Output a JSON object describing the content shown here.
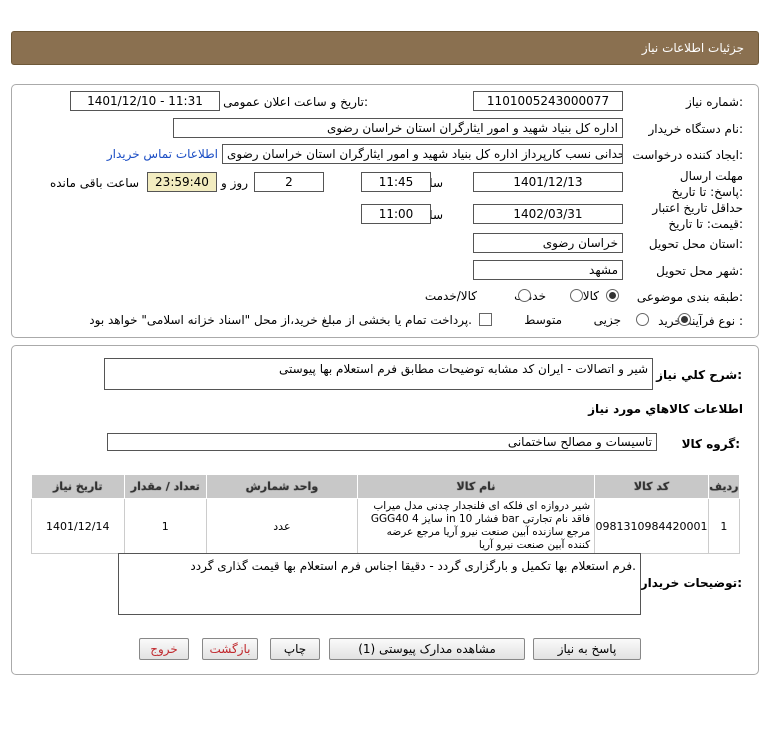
{
  "header": {
    "title": "جزئیات اطلاعات نیاز"
  },
  "form": {
    "need_number_label": "شماره نیاز:",
    "need_number": "1101005243000077",
    "announce_label": "تاریخ و ساعت اعلان عمومی:",
    "announce_value": "1401/12/10 - 11:31",
    "buyer_org_label": "نام دستگاه خریدار:",
    "buyer_org": "اداره کل بنیاد شهید و امور ایثارگران استان خراسان رضوی",
    "creator_label": "ایجاد کننده درخواست:",
    "creator": "حسین وحدانی نسب کارپرداز اداره کل بنیاد شهید و امور ایثارگران استان خراسان رضوی",
    "contact_link": "اطلاعات تماس خریدار",
    "deadline_label": "مهلت ارسال پاسخ: تا تاریخ:",
    "deadline_date": "1401/12/13",
    "time_label": "ساعت",
    "deadline_time": "11:45",
    "days_value": "2",
    "days_label": "روز و",
    "remaining_time": "23:59:40",
    "remaining_label": "ساعت باقی مانده",
    "validity_label": "حداقل تاریخ اعتبار قیمت: تا تاریخ:",
    "validity_date": "1402/03/31",
    "validity_time_label": "ساعت",
    "validity_time": "11:00",
    "province_label": "استان محل تحویل:",
    "province": "خراسان رضوی",
    "city_label": "شهر محل تحویل:",
    "city": "مشهد",
    "category_label": "طبقه بندی موضوعی:",
    "category_options": [
      "کالا",
      "خدمت",
      "کالا/خدمت"
    ],
    "process_label": "نوع فرآیند خرید :",
    "process_options": [
      "جزیی",
      "متوسط"
    ],
    "payment_note": "پرداخت تمام یا بخشی از مبلغ خرید،از محل \"اسناد خزانه اسلامی\" خواهد بود."
  },
  "details": {
    "summary_label": "شرح کلي نياز:",
    "summary": "شیر و اتصالات  - ایران کد مشابه توضیحات مطابق فرم استعلام بها پیوستی",
    "items_title": "اطلاعات کالاهاي مورد نياز",
    "group_label": "گروه کالا:",
    "group": "تاسیسات و مصالح ساختمانی",
    "table_headers": [
      "ردیف",
      "کد کالا",
      "نام کالا",
      "واحد شمارش",
      "تعداد / مقدار",
      "تاریخ نیاز"
    ],
    "rows": [
      {
        "row": "1",
        "code": "0981310984420001",
        "name": "شیر دروازه ای فلکه ای فلنجدار چدنی مدل میراب GGG40 سایز 4 in فشار 10 bar فاقد نام تجارتی مرجع سازنده آبین صنعت نیرو آریا مرجع عرضه کننده آبین صنعت نیرو آریا",
        "unit": "عدد",
        "qty": "1",
        "date": "1401/12/14"
      }
    ],
    "buyer_notes_label": "توضیحات خریدار:",
    "buyer_notes": "فرم استعلام بها تکمیل و بارگزاری گردد - دقیقا اجناس فرم استعلام بها قیمت گذاری گردد."
  },
  "buttons": {
    "reply": "پاسخ به نیاز",
    "attachments": "مشاهده مدارک پیوستی (1)",
    "print": "چاپ",
    "back": "بازگشت",
    "exit": "خروج"
  }
}
